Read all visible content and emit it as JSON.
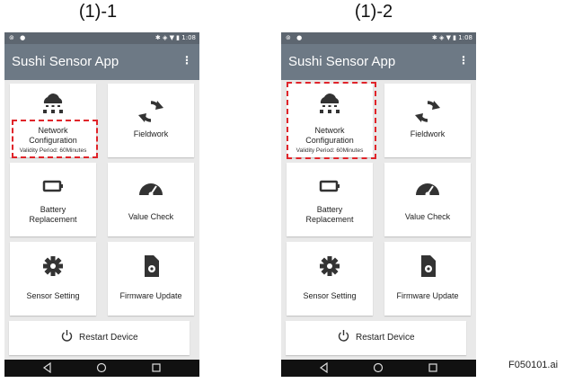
{
  "captions": {
    "left": "(1)-1",
    "right": "(1)-2"
  },
  "status": {
    "time": "1:08"
  },
  "app": {
    "title": "Sushi Sensor App",
    "menu_icon": "more-vert-icon"
  },
  "tiles": {
    "network": {
      "line1": "Network",
      "line2": "Configuration",
      "validity": "Validity Period: 60Minutes",
      "icon": "cloud-network-icon"
    },
    "fieldwork": {
      "label": "Fieldwork",
      "icon": "sync-icon"
    },
    "battery": {
      "line1": "Battery",
      "line2": "Replacement",
      "icon": "battery-icon"
    },
    "valuecheck": {
      "label": "Value Check",
      "icon": "gauge-icon"
    },
    "sensorsetting": {
      "label": "Sensor Setting",
      "icon": "gear-icon"
    },
    "firmware": {
      "label": "Firmware Update",
      "icon": "file-gear-icon"
    }
  },
  "restart": {
    "label": "Restart Device",
    "icon": "power-icon"
  },
  "highlight_color": "#e0242a",
  "figure_id": "F050101.ai"
}
